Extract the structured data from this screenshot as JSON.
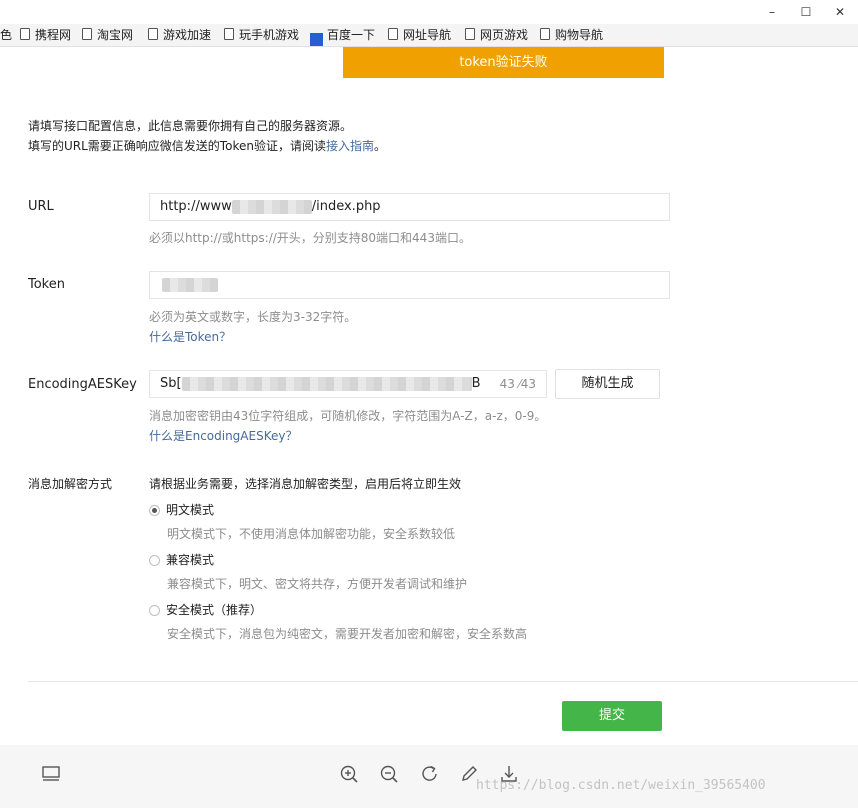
{
  "window": {
    "minimize": "–",
    "maximize": "☐",
    "close": "✕"
  },
  "bookmarks": {
    "partial": "色",
    "items": [
      "携程网",
      "淘宝网",
      "游戏加速",
      "玩手机游戏",
      "百度一下",
      "网址导航",
      "网页游戏",
      "购物导航"
    ],
    "baidu_glyph": "🐾"
  },
  "alert": {
    "text": "token验证失败"
  },
  "intro": {
    "line1": "请填写接口配置信息，此信息需要你拥有自己的服务器资源。",
    "line2_prefix": "填写的URL需要正确响应微信发送的Token验证，请阅读",
    "line2_link": "接入指南",
    "line2_suffix": "。"
  },
  "url": {
    "label": "URL",
    "value_prefix": "http://www",
    "value_suffix": "/index.php",
    "hint": "必须以http://或https://开头，分别支持80端口和443端口。"
  },
  "token": {
    "label": "Token",
    "hint": "必须为英文或数字，长度为3-32字符。",
    "link": "什么是Token？"
  },
  "aes": {
    "label": "EncodingAESKey",
    "value_prefix": "Sb[",
    "value_suffix": "B",
    "counter": "43 ⁄43",
    "random_button": "随机生成",
    "hint": "消息加密密钥由43位字符组成，可随机修改，字符范围为A-Z，a-z，0-9。",
    "link": "什么是EncodingAESKey？"
  },
  "encryption": {
    "label": "消息加解密方式",
    "description": "请根据业务需要，选择消息加解密类型，启用后将立即生效",
    "options": [
      {
        "label": "明文模式",
        "desc": "明文模式下，不使用消息体加解密功能，安全系数较低",
        "selected": true
      },
      {
        "label": "兼容模式",
        "desc": "兼容模式下，明文、密文将共存，方便开发者调试和维护",
        "selected": false
      },
      {
        "label": "安全模式（推荐）",
        "desc": "安全模式下，消息包为纯密文，需要开发者加密和解密，安全系数高",
        "selected": false
      }
    ]
  },
  "submit": {
    "label": "提交"
  },
  "watermark": "https://blog.csdn.net/weixin_39565400",
  "colors": {
    "alert": "#f0a000",
    "submit": "#44b549",
    "link": "#466a9a"
  }
}
